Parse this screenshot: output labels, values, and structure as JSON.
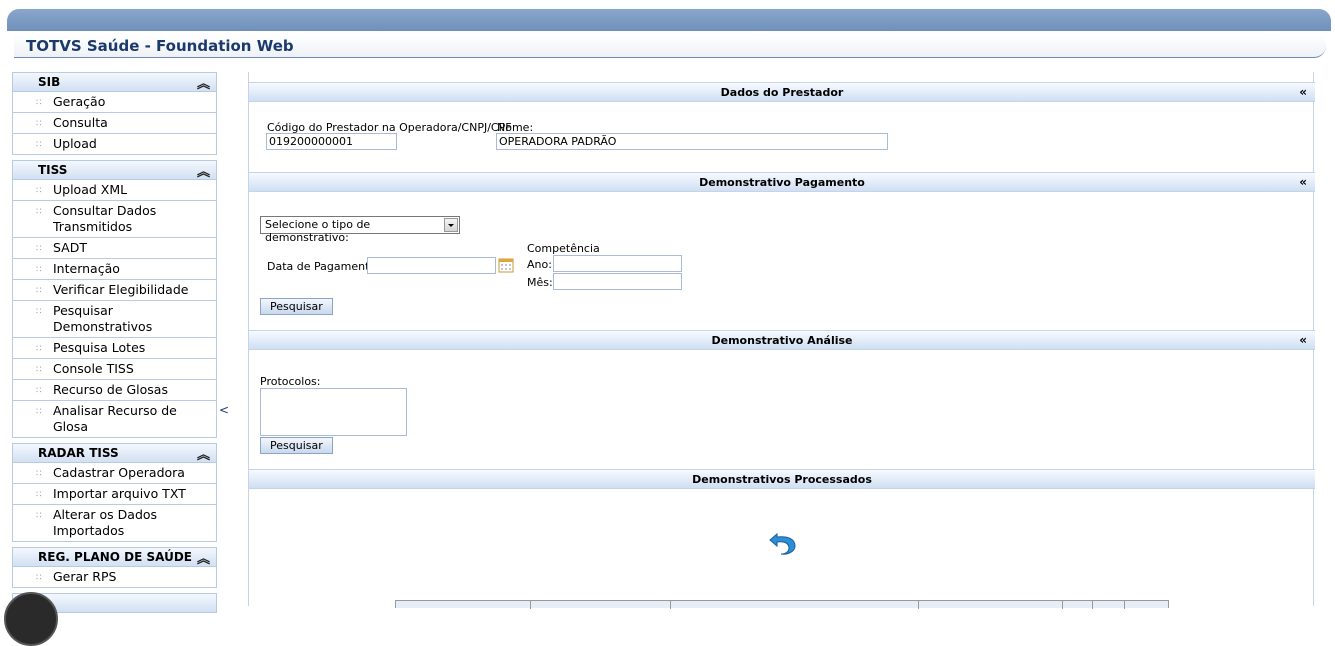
{
  "app": {
    "title": "TOTVS Saúde - Foundation Web"
  },
  "sidebar": {
    "collapse_glyph": "<",
    "groups": [
      {
        "title": "SIB",
        "items": [
          "Geração",
          "Consulta",
          "Upload"
        ]
      },
      {
        "title": "TISS",
        "items": [
          "Upload XML",
          "Consultar Dados Transmitidos",
          "SADT",
          "Internação",
          "Verificar Elegibilidade",
          "Pesquisar Demonstrativos",
          "Pesquisa Lotes",
          "Console TISS",
          "Recurso de Glosas",
          "Analisar Recurso de Glosa"
        ]
      },
      {
        "title": "RADAR TISS",
        "items": [
          "Cadastrar Operadora",
          "Importar arquivo TXT",
          "Alterar os Dados Importados"
        ]
      },
      {
        "title": "REG. PLANO DE SAÚDE",
        "items": [
          "Gerar RPS"
        ]
      }
    ]
  },
  "sections": {
    "prestador": {
      "title": "Dados do Prestador",
      "codigo_label": "Código do Prestador na Operadora/CNPJ/CPF",
      "codigo_value": "019200000001",
      "nome_label": "Nome:",
      "nome_value": "OPERADORA PADRÃO"
    },
    "pagamento": {
      "title": "Demonstrativo Pagamento",
      "tipo_select": "Selecione o tipo de demonstrativo:",
      "data_label": "Data de Pagamento:",
      "data_value": "",
      "competencia_label": "Competência",
      "ano_label": "Ano:",
      "ano_value": "",
      "mes_label": "Mês:",
      "mes_value": "",
      "search_button": "Pesquisar"
    },
    "analise": {
      "title": "Demonstrativo Análise",
      "protocolos_label": "Protocolos:",
      "search_button": "Pesquisar"
    },
    "processados": {
      "title": "Demonstrativos Processados"
    }
  },
  "icons": {
    "collapse": "«",
    "group_toggle": "≈",
    "undo": "undo-arrow-icon",
    "calendar": "calendar-icon"
  },
  "colors": {
    "brand": "#1b3a6c",
    "topbar": "#7b9ac3",
    "header_bg": "#d1e0f3",
    "border": "#b9cbe2"
  }
}
